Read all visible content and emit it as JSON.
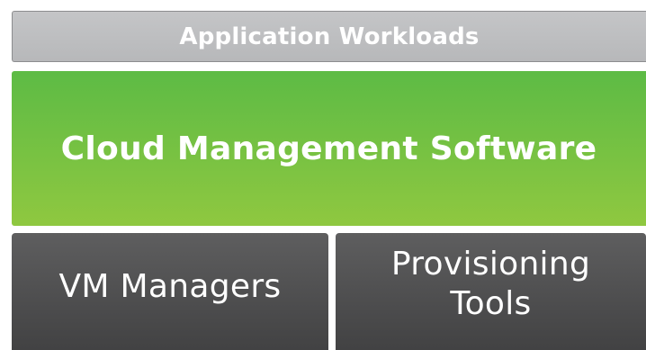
{
  "layers": {
    "top": {
      "label": "Application Workloads",
      "color": "#bdbec0"
    },
    "middle": {
      "label": "Cloud Management Software",
      "color": "#72c043"
    },
    "bottom": [
      {
        "label": "VM Managers",
        "color": "#4f4f50"
      },
      {
        "label": "Provisioning Tools",
        "line1": "Provisioning",
        "line2": "Tools",
        "color": "#4f4f50"
      }
    ]
  }
}
